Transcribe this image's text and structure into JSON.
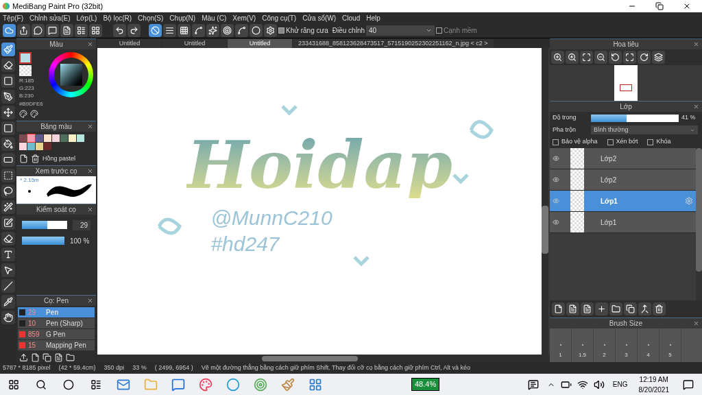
{
  "window": {
    "title": "MediBang Paint Pro (32bit)"
  },
  "menu": [
    "Tệp(F)",
    "Chỉnh sửa(E)",
    "Lớp(L)",
    "Bộ lọc(R)",
    "Chọn(S)",
    "Chụp(N)",
    "Màu (C)",
    "Xem(V)",
    "Công cụ(T)",
    "Cửa sổ(W)",
    "Cloud",
    "Help"
  ],
  "toolbar": {
    "antialias": {
      "label": "Khử răng cưa",
      "checked": true
    },
    "correction": {
      "label": "Điều chỉnh",
      "value": "40"
    },
    "soft_edge": {
      "label": "Cạnh mềm",
      "checked": false
    }
  },
  "tools": [
    {
      "kind": "brush",
      "selected": true
    },
    {
      "kind": "eraser",
      "selected": false
    },
    {
      "kind": "shape",
      "selected": false
    },
    {
      "kind": "dot",
      "selected": false
    },
    {
      "kind": "move",
      "selected": false
    },
    {
      "kind": "fill",
      "selected": false
    },
    {
      "kind": "bucket",
      "selected": false
    },
    {
      "kind": "gradient",
      "selected": false
    },
    {
      "kind": "select",
      "selected": false
    },
    {
      "kind": "lasso",
      "selected": false
    },
    {
      "kind": "wand",
      "selected": false
    },
    {
      "kind": "select-pen",
      "selected": false
    },
    {
      "kind": "select-eraser",
      "selected": false
    },
    {
      "kind": "text",
      "selected": false
    },
    {
      "kind": "operation",
      "selected": false
    },
    {
      "kind": "divide",
      "selected": false
    },
    {
      "kind": "eyedropper",
      "selected": false
    },
    {
      "kind": "hand",
      "selected": false
    }
  ],
  "color_panel": {
    "title": "Màu",
    "swatch": {
      "color": "#b9dfe6"
    },
    "readouts": [
      "R:185",
      "G:223",
      "B:230"
    ],
    "hex": "#B9DFE6"
  },
  "palette": {
    "title": "Bảng màu",
    "name": "Hồng pastel",
    "swatches": [
      {
        "color": "#7a4a4f",
        "selected": false
      },
      {
        "color": "#f49cb0",
        "selected": true
      },
      {
        "color": "#5e5a8e",
        "selected": false
      },
      {
        "color": "#fde3cd",
        "selected": false
      },
      {
        "color": "#f9d3dc",
        "selected": false
      },
      {
        "color": "#4f6e5c",
        "selected": false
      },
      {
        "color": "#fdf0c8",
        "selected": false
      },
      {
        "color": "#b5e6e0",
        "selected": false
      },
      {
        "color": "#fbd6df",
        "selected": false
      },
      {
        "color": "#6fbccc",
        "selected": false
      },
      {
        "color": "#e8d48f",
        "selected": false
      },
      {
        "color": "#6b2a2a",
        "selected": false
      }
    ]
  },
  "brush_preview": {
    "title": "Xem trước cọ",
    "size": "* 2.15m"
  },
  "brush_control": {
    "title": "Kiểm soát cọ",
    "size": {
      "level": 0.55,
      "value": "29"
    },
    "opacity": {
      "level": 1,
      "value": "100 %"
    }
  },
  "brushes": {
    "title": "Cọ: Pen",
    "items": [
      {
        "color": "#222222",
        "size": "29",
        "name": "Pen",
        "selected": true
      },
      {
        "color": "#222222",
        "size": "10",
        "name": "Pen (Sharp)",
        "selected": false
      },
      {
        "color": "#ee3333",
        "size": "859",
        "name": "G Pen",
        "selected": false
      },
      {
        "color": "#ee3333",
        "size": "15",
        "name": "Mapping Pen",
        "selected": false
      }
    ]
  },
  "tabs": [
    {
      "label": "Untitled",
      "selected": false
    },
    {
      "label": "Untitled",
      "selected": false
    },
    {
      "label": "Untitled",
      "selected": true
    },
    {
      "label": "233431688_858123628473517_5715190252302251162_n.jpg < c2 >",
      "selected": false
    }
  ],
  "canvas": {
    "lettering": "Hoidap",
    "signature": [
      "@MunnC210",
      "#hd247"
    ]
  },
  "navigator": {
    "title": "Hoa tiêu"
  },
  "layers": {
    "title": "Lớp",
    "opacity": {
      "label": "Độ trong",
      "level": 0.41,
      "value": "41 %"
    },
    "blend": {
      "label": "Pha trộn",
      "value": "Bình thường"
    },
    "options": [
      {
        "label": "Bảo vệ alpha",
        "checked": false
      },
      {
        "label": "Xén bớt",
        "checked": false
      },
      {
        "label": "Khóa",
        "checked": false
      }
    ],
    "items": [
      {
        "name": "Lớp2",
        "selected": false
      },
      {
        "name": "Lớp2",
        "selected": false
      },
      {
        "name": "Lớp1",
        "selected": true
      },
      {
        "name": "Lớp1",
        "selected": false
      }
    ]
  },
  "brush_size": {
    "title": "Brush Size",
    "sizes": [
      "1",
      "1.5",
      "2",
      "3",
      "4",
      "5"
    ]
  },
  "status_bar": [
    "5787 * 8185 pixel",
    "(42 * 59.4cm)",
    "350 dpi",
    "33 %",
    "( 2499, 6954 )",
    "Vẽ một đường thẳng bằng cách giữ phím Shift. Thay đổi cỡ cọ bằng cách giữ phím Ctrl, Alt và kéo"
  ],
  "taskbar": {
    "battery": "48.4%",
    "language": "ENG",
    "time": "12:19 AM",
    "date": "8/20/2021"
  }
}
